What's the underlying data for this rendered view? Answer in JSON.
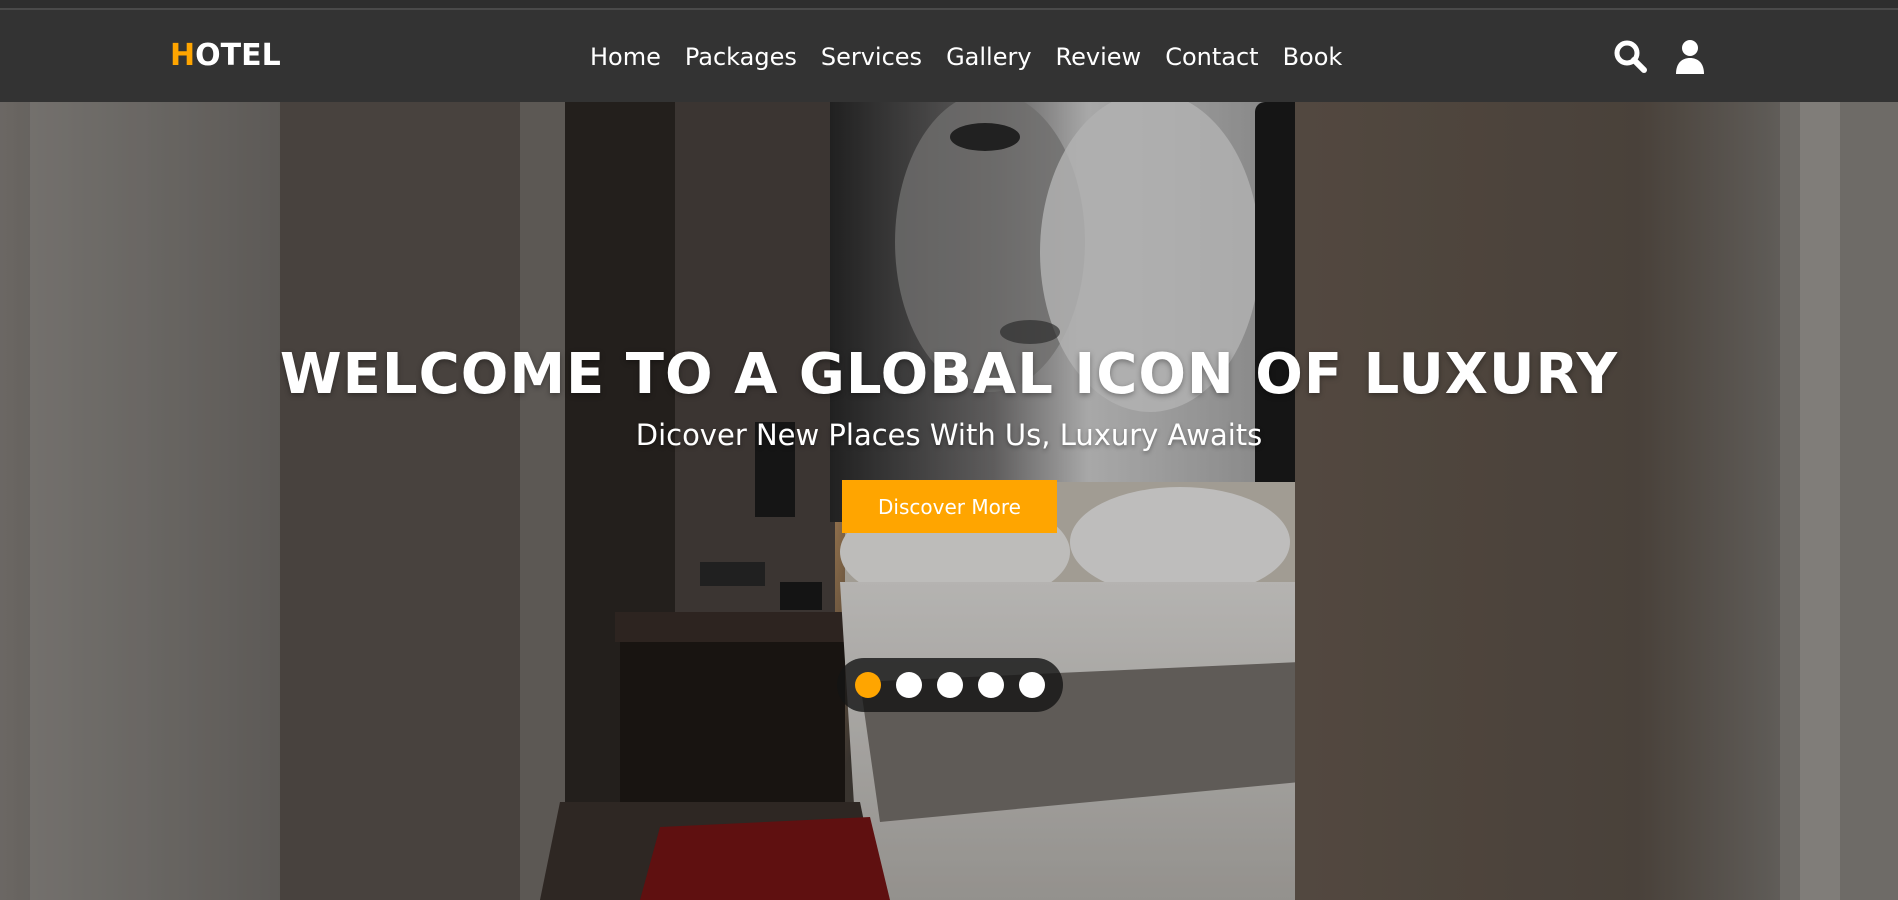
{
  "brand": {
    "first_letter": "H",
    "rest": "OTEL",
    "accent_color": "#ffa500"
  },
  "nav": {
    "items": [
      {
        "label": "Home"
      },
      {
        "label": "Packages"
      },
      {
        "label": "Services"
      },
      {
        "label": "Gallery"
      },
      {
        "label": "Review"
      },
      {
        "label": "Contact"
      },
      {
        "label": "Book"
      }
    ],
    "icons": [
      "search-icon",
      "user-icon"
    ]
  },
  "hero": {
    "title": "WELCOME TO A GLOBAL ICON OF LUXURY",
    "subtitle": "Dicover New Places With Us, Luxury Awaits",
    "button_label": "Discover More",
    "slides_count": 5,
    "active_slide": 1
  },
  "colors": {
    "header_bg": "#333333",
    "accent": "#ffa500",
    "text": "#ffffff"
  }
}
